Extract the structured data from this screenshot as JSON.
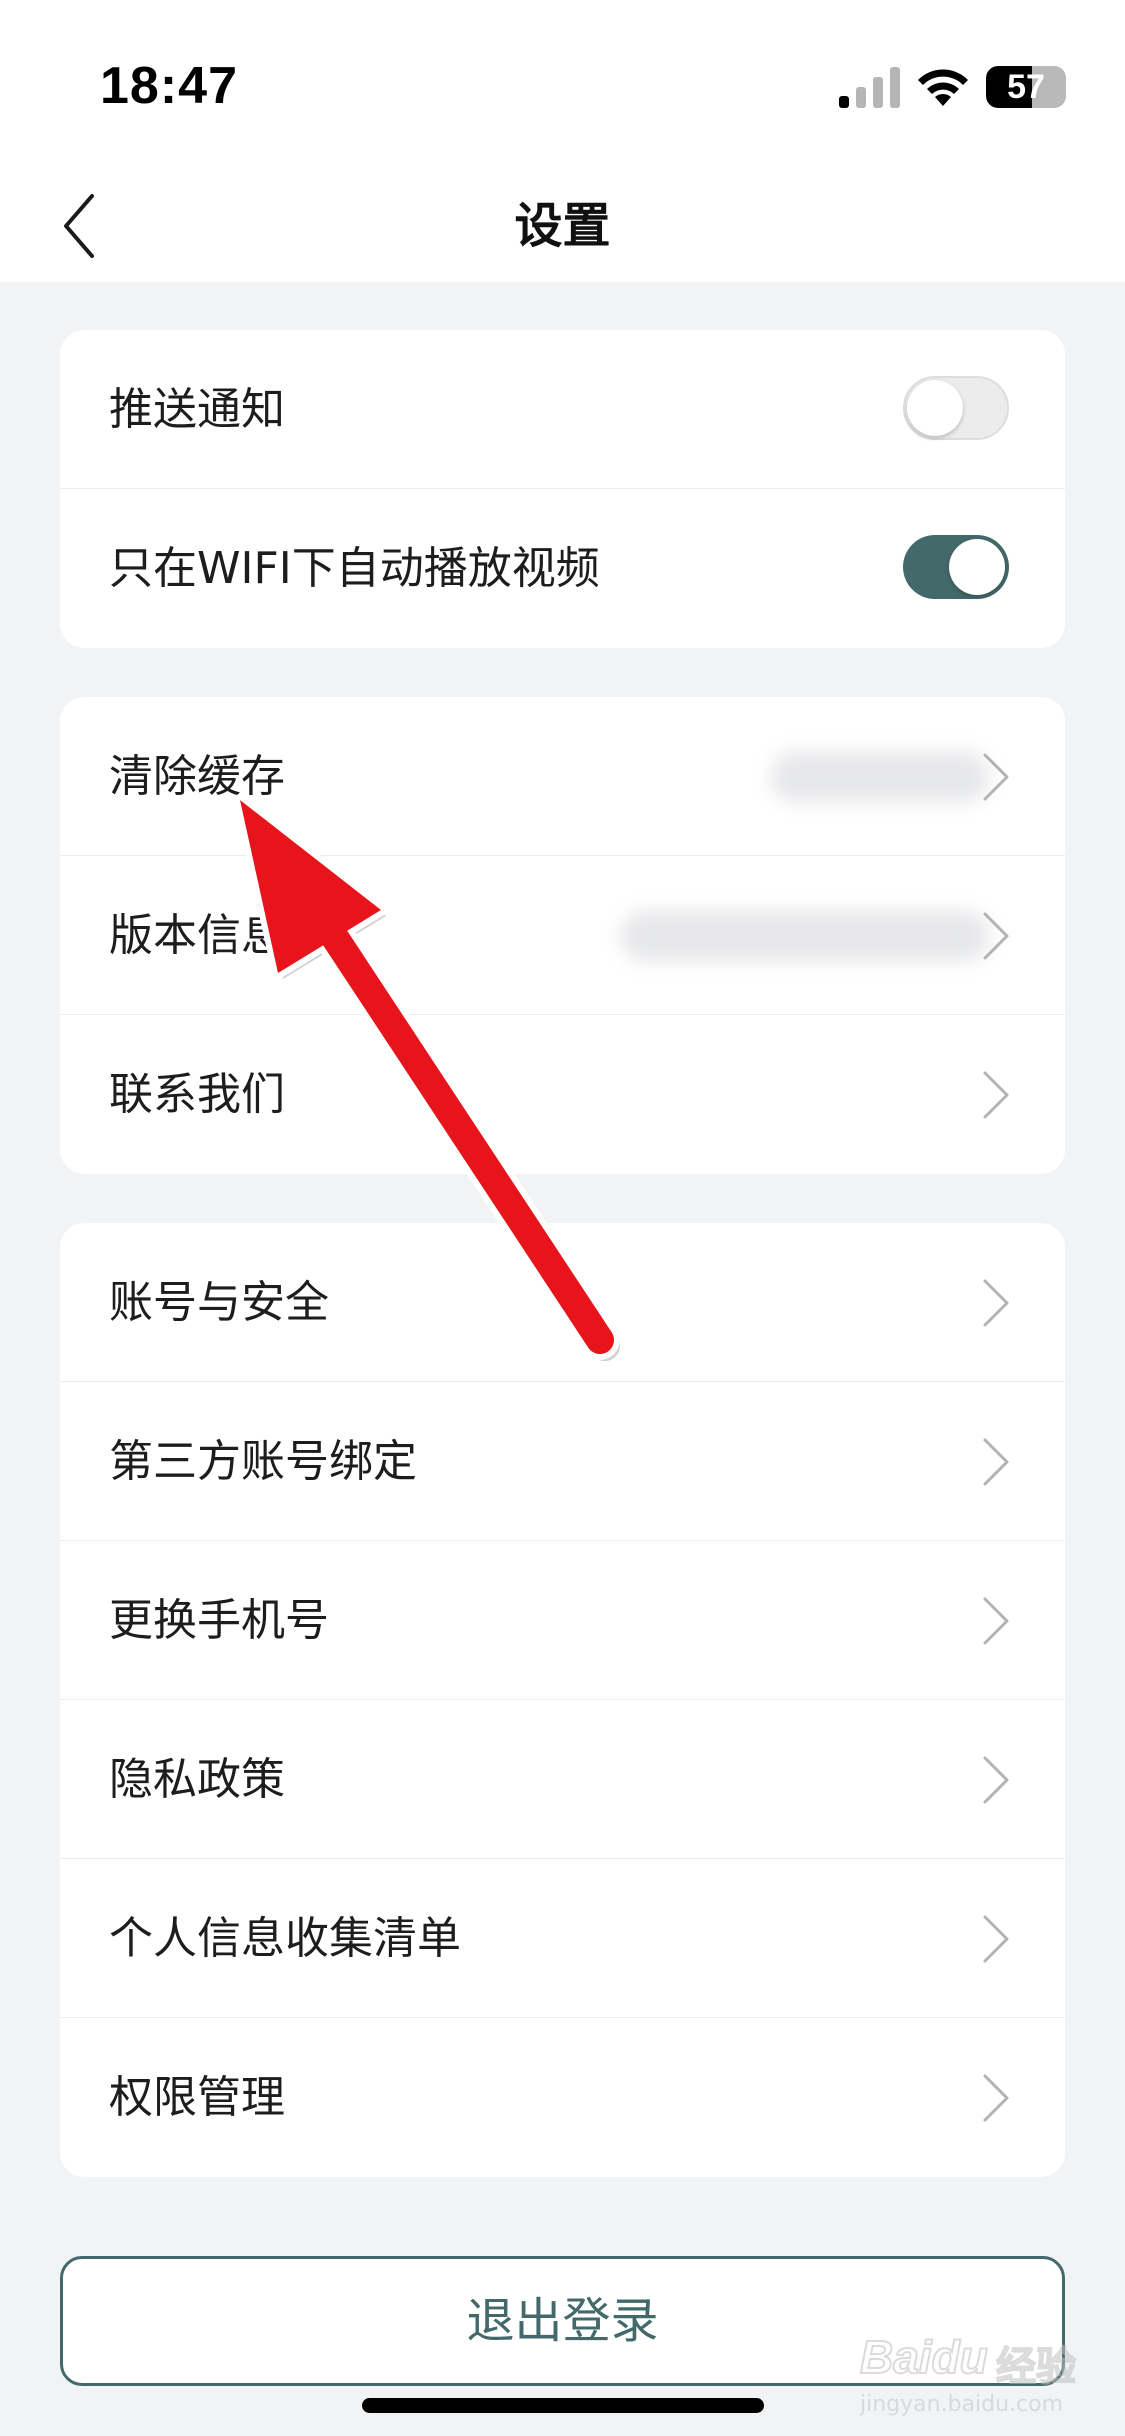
{
  "status_bar": {
    "time": "18:47",
    "battery_level": "57",
    "icons": [
      "cellular-signal-icon",
      "wifi-icon",
      "battery-icon"
    ]
  },
  "nav": {
    "title": "设置",
    "back_icon": "chevron-left-icon"
  },
  "groups": [
    {
      "rows": [
        {
          "label": "推送通知",
          "control": "toggle",
          "on": false
        },
        {
          "label": "只在WIFI下自动播放视频",
          "control": "toggle",
          "on": true
        }
      ]
    },
    {
      "rows": [
        {
          "label": "清除缓存",
          "control": "chevron",
          "value_obscured": true
        },
        {
          "label": "版本信息",
          "control": "chevron",
          "value_obscured": true
        },
        {
          "label": "联系我们",
          "control": "chevron"
        }
      ]
    },
    {
      "rows": [
        {
          "label": "账号与安全",
          "control": "chevron"
        },
        {
          "label": "第三方账号绑定",
          "control": "chevron"
        },
        {
          "label": "更换手机号",
          "control": "chevron"
        },
        {
          "label": "隐私政策",
          "control": "chevron"
        },
        {
          "label": "个人信息收集清单",
          "control": "chevron"
        },
        {
          "label": "权限管理",
          "control": "chevron"
        }
      ]
    }
  ],
  "logout": {
    "label": "退出登录"
  },
  "watermark": {
    "brand": "Baidu",
    "brand_cn": "经验",
    "url": "jingyan.baidu.com"
  },
  "colors": {
    "accent": "#44696b",
    "background": "#f2f3f5",
    "card": "#ffffff",
    "annotation_arrow": "#e8141c"
  }
}
